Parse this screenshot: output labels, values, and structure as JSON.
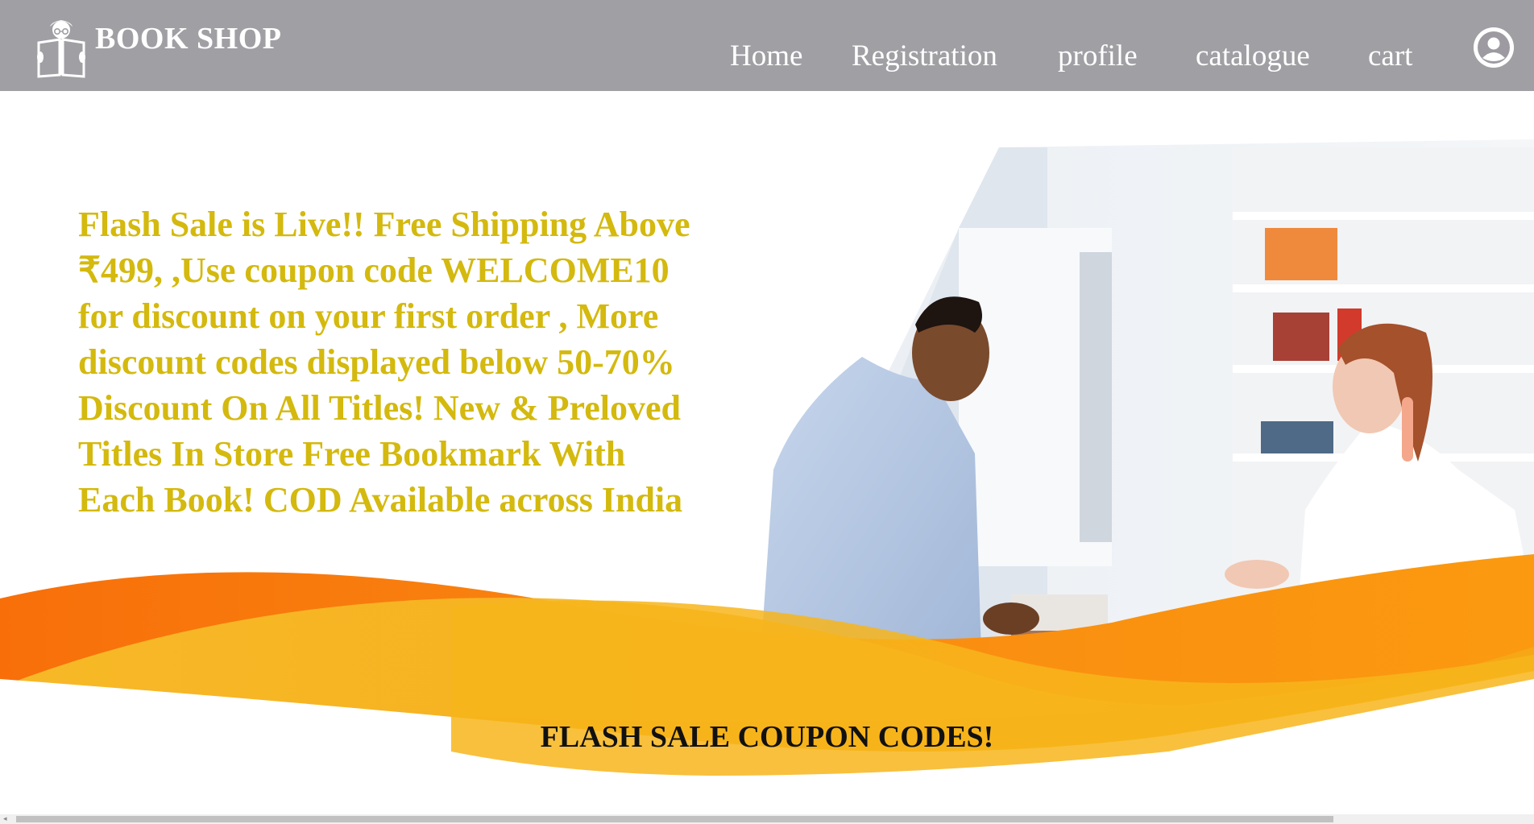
{
  "header": {
    "brand": "BOOK SHOP",
    "nav": [
      {
        "label": "Home"
      },
      {
        "label": "Registration"
      },
      {
        "label": "profile"
      },
      {
        "label": "catalogue"
      },
      {
        "label": "cart"
      }
    ],
    "avatar_icon": "user-avatar-icon"
  },
  "hero": {
    "promo_text": "Flash Sale is Live!! Free Shipping Above ₹499, ,Use coupon code WELCOME10 for discount on your first order , More discount codes displayed below 50-70% Discount On All Titles! New & Preloved Titles In Store Free Bookmark With Each Book! COD Available across India",
    "coupon_heading": "FLASH SALE COUPON CODES!"
  },
  "colors": {
    "header_bg": "#a09fa4",
    "promo_text": "#d4b90e",
    "wave_orange": "#f97d12",
    "wave_yellow": "#f7b21a"
  }
}
